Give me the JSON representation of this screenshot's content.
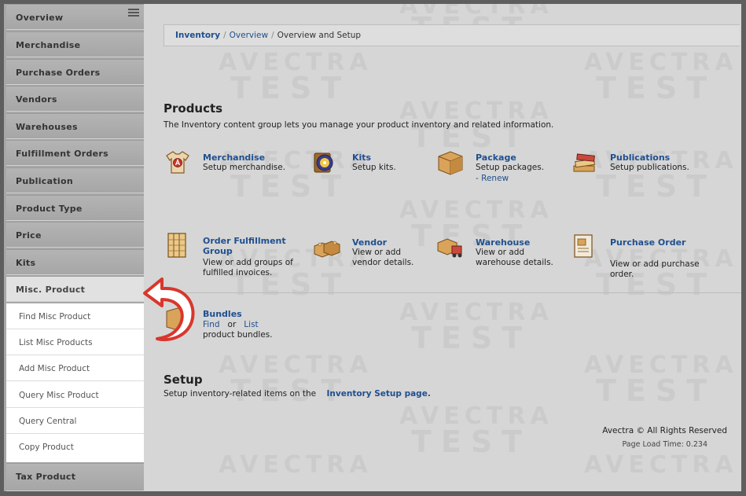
{
  "sidebar": {
    "items": [
      {
        "label": "Overview"
      },
      {
        "label": "Merchandise"
      },
      {
        "label": "Purchase Orders"
      },
      {
        "label": "Vendors"
      },
      {
        "label": "Warehouses"
      },
      {
        "label": "Fulfillment Orders"
      },
      {
        "label": "Publication"
      },
      {
        "label": "Product Type"
      },
      {
        "label": "Price"
      },
      {
        "label": "Kits"
      },
      {
        "label": "Misc. Product"
      },
      {
        "label": "Tax Product"
      }
    ],
    "sub_items": [
      {
        "label": "Find Misc Product"
      },
      {
        "label": "List Misc Products"
      },
      {
        "label": "Add Misc Product"
      },
      {
        "label": "Query Misc Product"
      },
      {
        "label": "Query Central"
      },
      {
        "label": "Copy Product"
      }
    ],
    "menu_icon": "hamburger-icon"
  },
  "breadcrumb": {
    "root": "Inventory",
    "sep": "/",
    "middle": "Overview",
    "current": "Overview and Setup"
  },
  "watermark": {
    "line1": "AVECTRA",
    "line2": "TEST"
  },
  "products": {
    "title": "Products",
    "intro": "The Inventory content group lets you manage your product inventory and related information.",
    "tiles": [
      {
        "name": "Merchandise",
        "desc": "Setup merchandise.",
        "icon": "tshirt-icon"
      },
      {
        "name": "Kits",
        "desc": "Setup kits.",
        "icon": "kit-disc-icon"
      },
      {
        "name": "Package",
        "desc": "Setup packages.",
        "link": "- Renew",
        "icon": "box-icon"
      },
      {
        "name": "Publications",
        "desc": "Setup publications.",
        "icon": "books-icon"
      },
      {
        "name": "Order Fulfillment Group",
        "desc": "View or add groups of fulfilled invoices.",
        "icon": "ledger-icon"
      },
      {
        "name": "Vendor",
        "desc": "View or add vendor details.",
        "icon": "vendor-crates-icon"
      },
      {
        "name": "Warehouse",
        "desc": "View or add warehouse details.",
        "icon": "forklift-icon"
      },
      {
        "name": "Purchase Order",
        "desc": "View or add purchase order.",
        "icon": "order-doc-icon"
      }
    ],
    "bundles": {
      "name": "Bundles",
      "find": "Find",
      "or": "or",
      "list": "List",
      "desc": "product bundles.",
      "icon": "bundle-icon"
    }
  },
  "setup": {
    "title": "Setup",
    "text": "Setup inventory-related items on the",
    "link": "Inventory Setup page."
  },
  "footer": {
    "copyright": "Avectra © All Rights Reserved",
    "load_time": "Page Load Time: 0.234"
  },
  "colors": {
    "link": "#1f4f8f",
    "arrow": "#d9362c",
    "sidebar": "#a8a8a8"
  }
}
